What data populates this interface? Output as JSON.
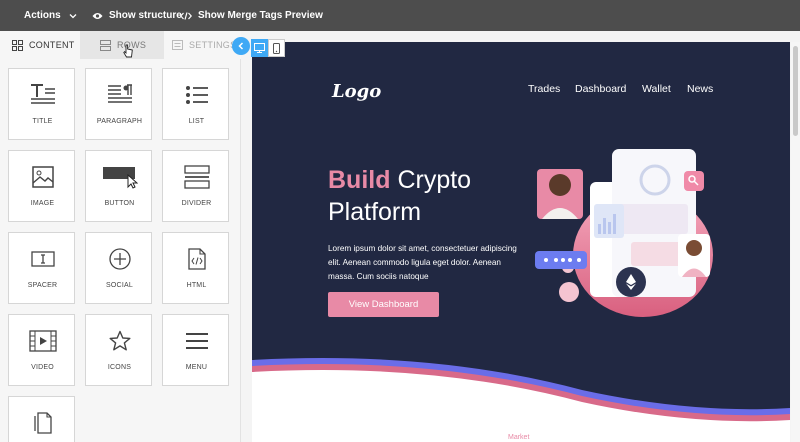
{
  "toolbar": {
    "actions_label": "Actions",
    "show_structure_label": "Show structure",
    "merge_tags_label": "Show Merge Tags Preview"
  },
  "panel": {
    "tabs": [
      {
        "label": "CONTENT",
        "icon": "grid-icon"
      },
      {
        "label": "ROWS",
        "icon": "rows-icon"
      },
      {
        "label": "SETTINGS",
        "icon": "settings-icon"
      }
    ],
    "blocks": [
      {
        "label": "TITLE",
        "icon": "title-icon"
      },
      {
        "label": "PARAGRAPH",
        "icon": "paragraph-icon"
      },
      {
        "label": "LIST",
        "icon": "list-icon"
      },
      {
        "label": "IMAGE",
        "icon": "image-icon"
      },
      {
        "label": "BUTTON",
        "icon": "button-icon"
      },
      {
        "label": "DIVIDER",
        "icon": "divider-icon"
      },
      {
        "label": "SPACER",
        "icon": "spacer-icon"
      },
      {
        "label": "SOCIAL",
        "icon": "social-icon"
      },
      {
        "label": "HTML",
        "icon": "html-icon"
      },
      {
        "label": "VIDEO",
        "icon": "video-icon"
      },
      {
        "label": "ICONS",
        "icon": "star-icon"
      },
      {
        "label": "MENU",
        "icon": "menu-icon"
      },
      {
        "label": "",
        "icon": "file-icon"
      }
    ]
  },
  "canvas": {
    "logo": "Logo",
    "nav": [
      "Trades",
      "Dashboard",
      "Wallet",
      "News"
    ],
    "headline_accent": "Build",
    "headline_rest": " Crypto",
    "headline_line2": "Platform",
    "body": "Lorem ipsum dolor sit amet, consectetuer adipiscing elit. Aenean commodo ligula eget dolor. Aenean massa. Cum sociis natoque",
    "cta_label": "View Dashboard",
    "next_section_label": "Market"
  },
  "colors": {
    "toolbar_bg": "#4d4d4d",
    "accent_blue": "#3fa9f5",
    "hero_bg": "#212842",
    "brand_pink": "#e88aa6"
  }
}
